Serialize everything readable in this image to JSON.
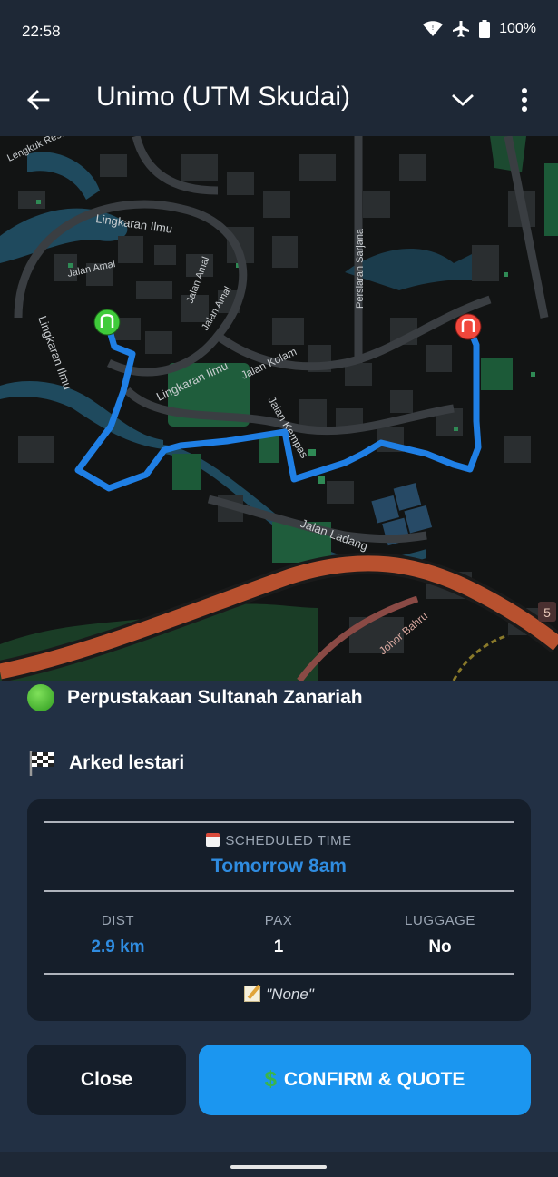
{
  "status_bar": {
    "time": "22:58",
    "battery": "100%"
  },
  "app_bar": {
    "title": "Unimo (UTM Skudai)"
  },
  "map": {
    "labels": {
      "lingkukresak": "Lengkuk Resak",
      "lingkaran_ilmu_top": "Lingkaran Ilmu",
      "jalan_amal_1": "Jalan Amal",
      "jalan_amal_2": "Jalan Amal",
      "jalan_amal_3": "Jalan Amal",
      "lingkaran_ilmu_left": "Lingkaran Ilmu",
      "lingkaran_ilmu_mid": "Lingkaran Ilmu",
      "persiaran_sarjana": "Persiaran Sarjana",
      "jalan_kolam": "Jalan Kolam",
      "jalan_kempas": "Jalan Kempas",
      "jalan_ladang": "Jalan Ladang",
      "johor_bahru": "Johor Bahru",
      "route_badge": "5"
    },
    "colors": {
      "route": "#1f7fe5",
      "origin_pin": "#3fcb3a",
      "dest_pin": "#f0473c",
      "highway": "#b8512f",
      "water": "#1f4a5e"
    }
  },
  "trip": {
    "origin": "Perpustakaan Sultanah Zanariah",
    "destination": "Arked lestari",
    "scheduled_label": "SCHEDULED TIME",
    "scheduled_value": "Tomorrow 8am",
    "stats": {
      "dist_label": "DIST",
      "dist_value": "2.9 km",
      "pax_label": "PAX",
      "pax_value": "1",
      "luggage_label": "LUGGAGE",
      "luggage_value": "No"
    },
    "note": "\"None\""
  },
  "actions": {
    "close_label": "Close",
    "confirm_label": "CONFIRM & QUOTE"
  }
}
